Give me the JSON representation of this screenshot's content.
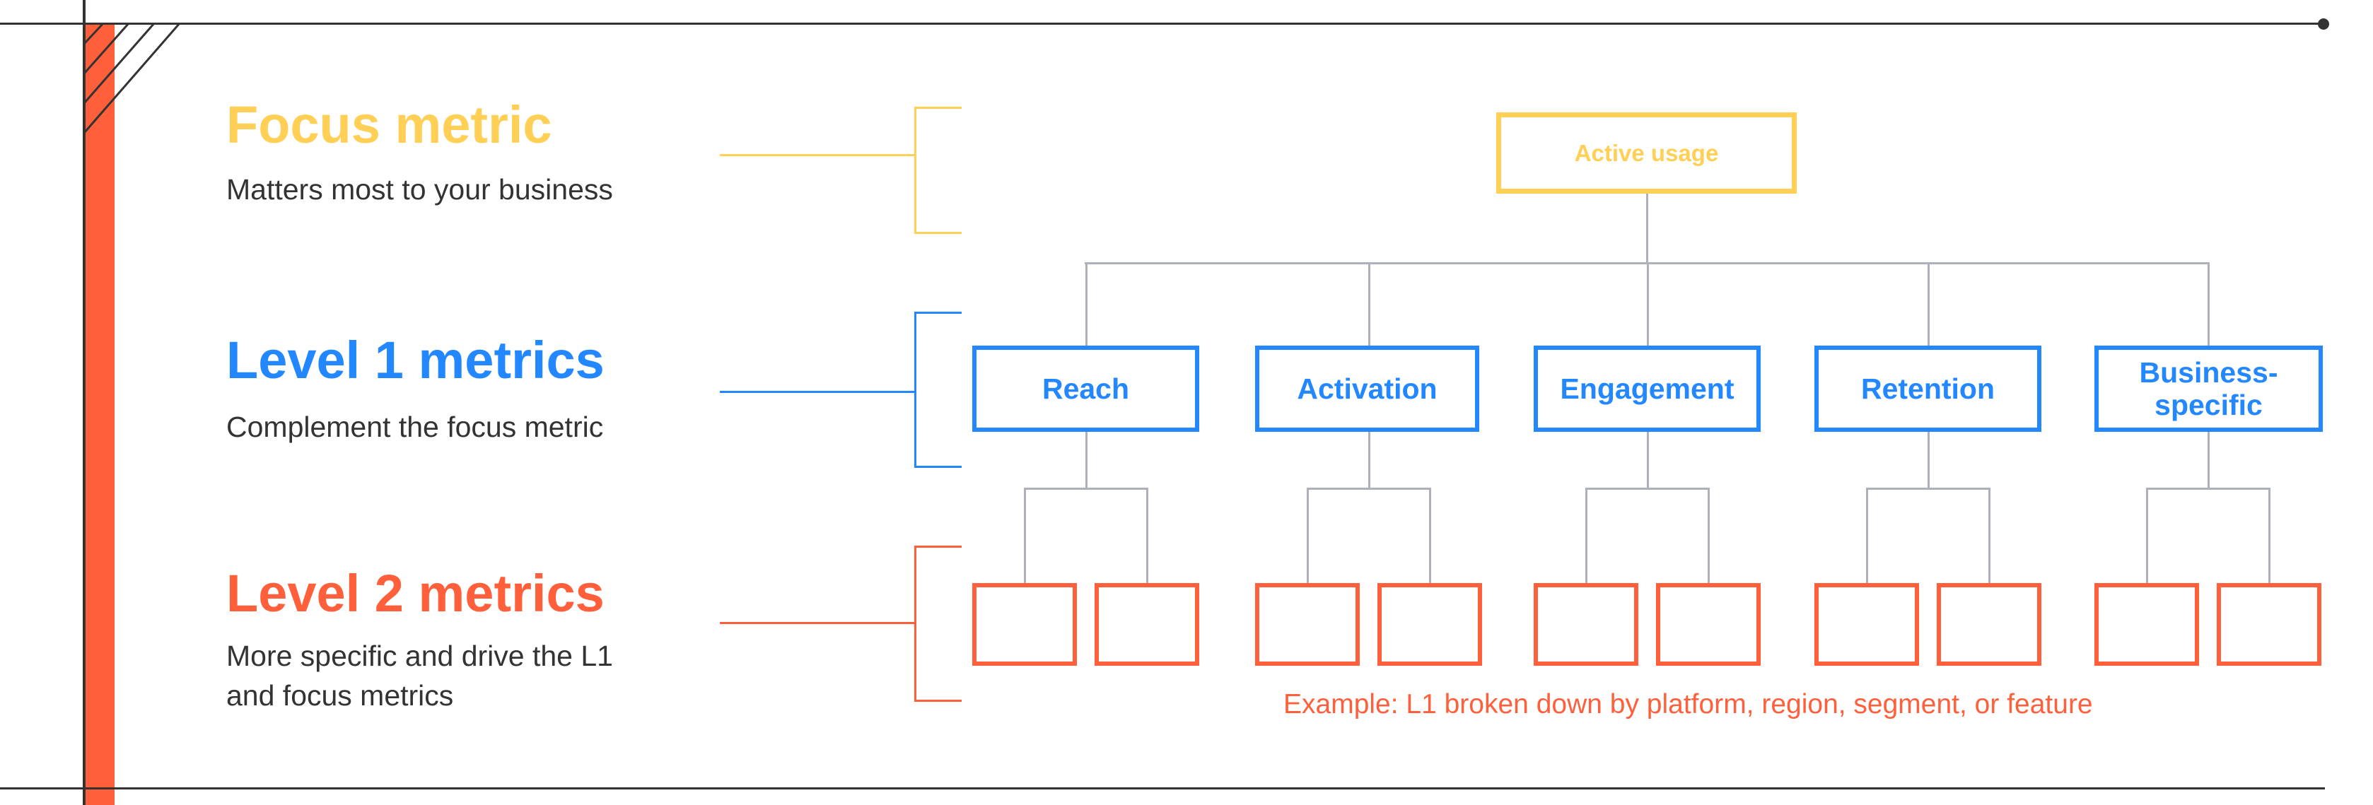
{
  "colors": {
    "focus": "#FFCF56",
    "level1": "#2388FF",
    "level2": "#FF5F3B",
    "connector": "#AEB0BB",
    "text": "#333333",
    "accent_bar": "#FF5F3B"
  },
  "legend": {
    "focus": {
      "title": "Focus metric",
      "description": "Matters most to your business"
    },
    "level1": {
      "title": "Level 1 metrics",
      "description": "Complement the focus metric"
    },
    "level2": {
      "title": "Level 2 metrics",
      "description_line1": "More specific and drive the L1",
      "description_line2": "and focus metrics"
    }
  },
  "tree": {
    "focus_metric": "Active usage",
    "level1": [
      {
        "label": "Reach",
        "children": 2
      },
      {
        "label": "Activation",
        "children": 2
      },
      {
        "label": "Engagement",
        "children": 2
      },
      {
        "label": "Retention",
        "children": 2
      },
      {
        "label_line1": "Business-",
        "label_line2": "specific",
        "children": 2
      }
    ],
    "level2_note": "Example: L1 broken down by platform, region, segment, or feature"
  }
}
